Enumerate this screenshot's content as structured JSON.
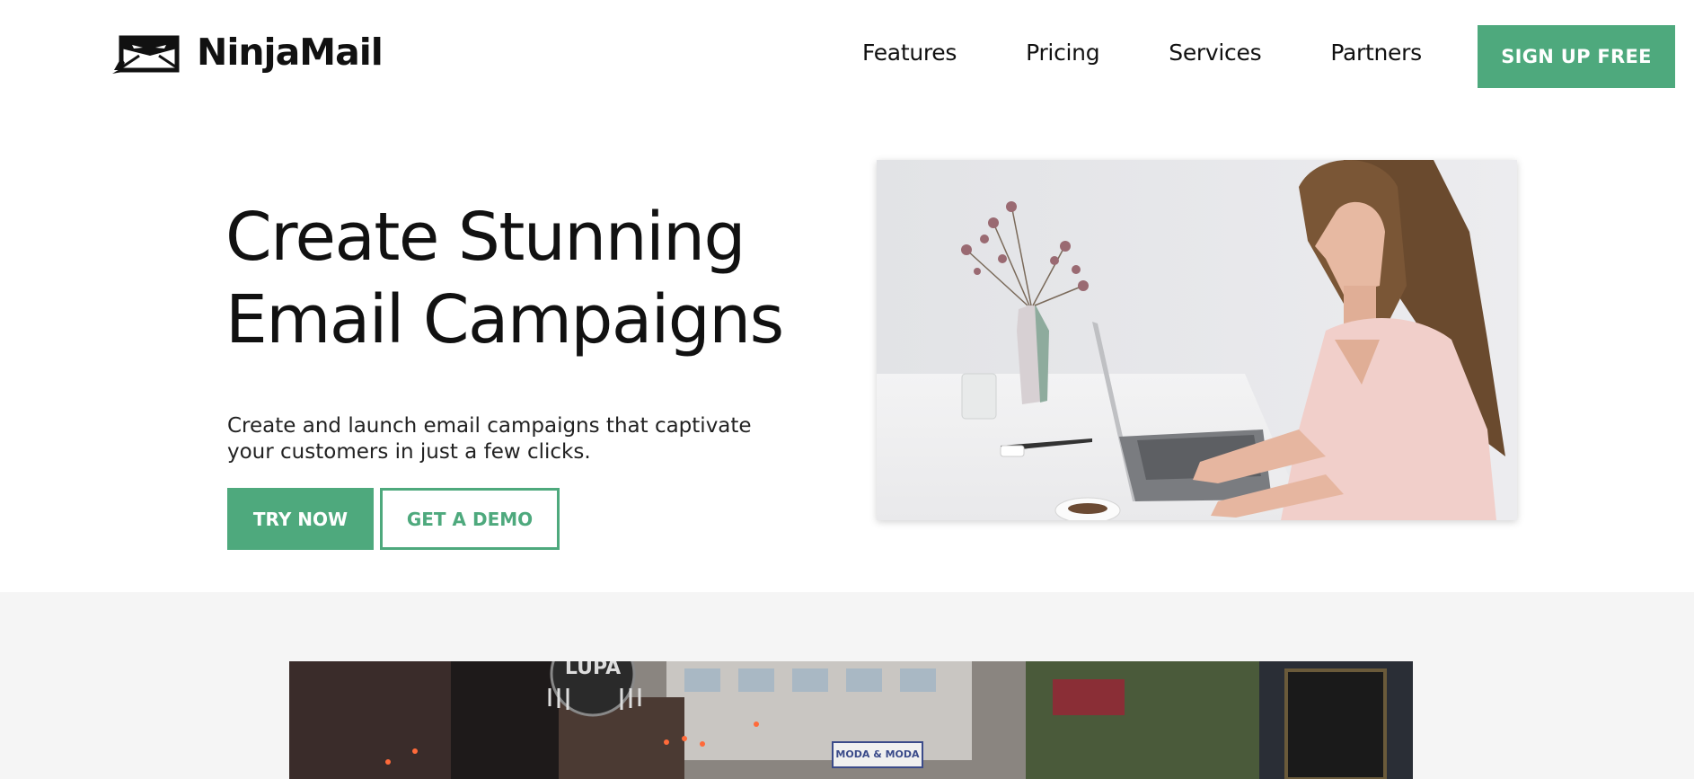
{
  "header": {
    "brand": "NinjaMail",
    "nav": [
      {
        "label": "Features"
      },
      {
        "label": "Pricing"
      },
      {
        "label": "Services"
      },
      {
        "label": "Partners"
      }
    ],
    "signup_label": "SIGN UP FREE"
  },
  "hero": {
    "title_line1": "Create Stunning",
    "title_line2": "Email Campaigns",
    "subtitle_line1": "Create and launch email campaigns that captivate",
    "subtitle_line2": "your customers in just a few clicks.",
    "try_label": "TRY NOW",
    "demo_label": "GET A DEMO"
  },
  "street_photo": {
    "sign_lupa": "LUPA",
    "sign_moda": "MODA & MODA"
  },
  "colors": {
    "accent": "#4ea97d",
    "lower_bg": "#f5f5f5",
    "text": "#111111"
  },
  "icons": {
    "logo": "ninja-envelope-icon"
  }
}
